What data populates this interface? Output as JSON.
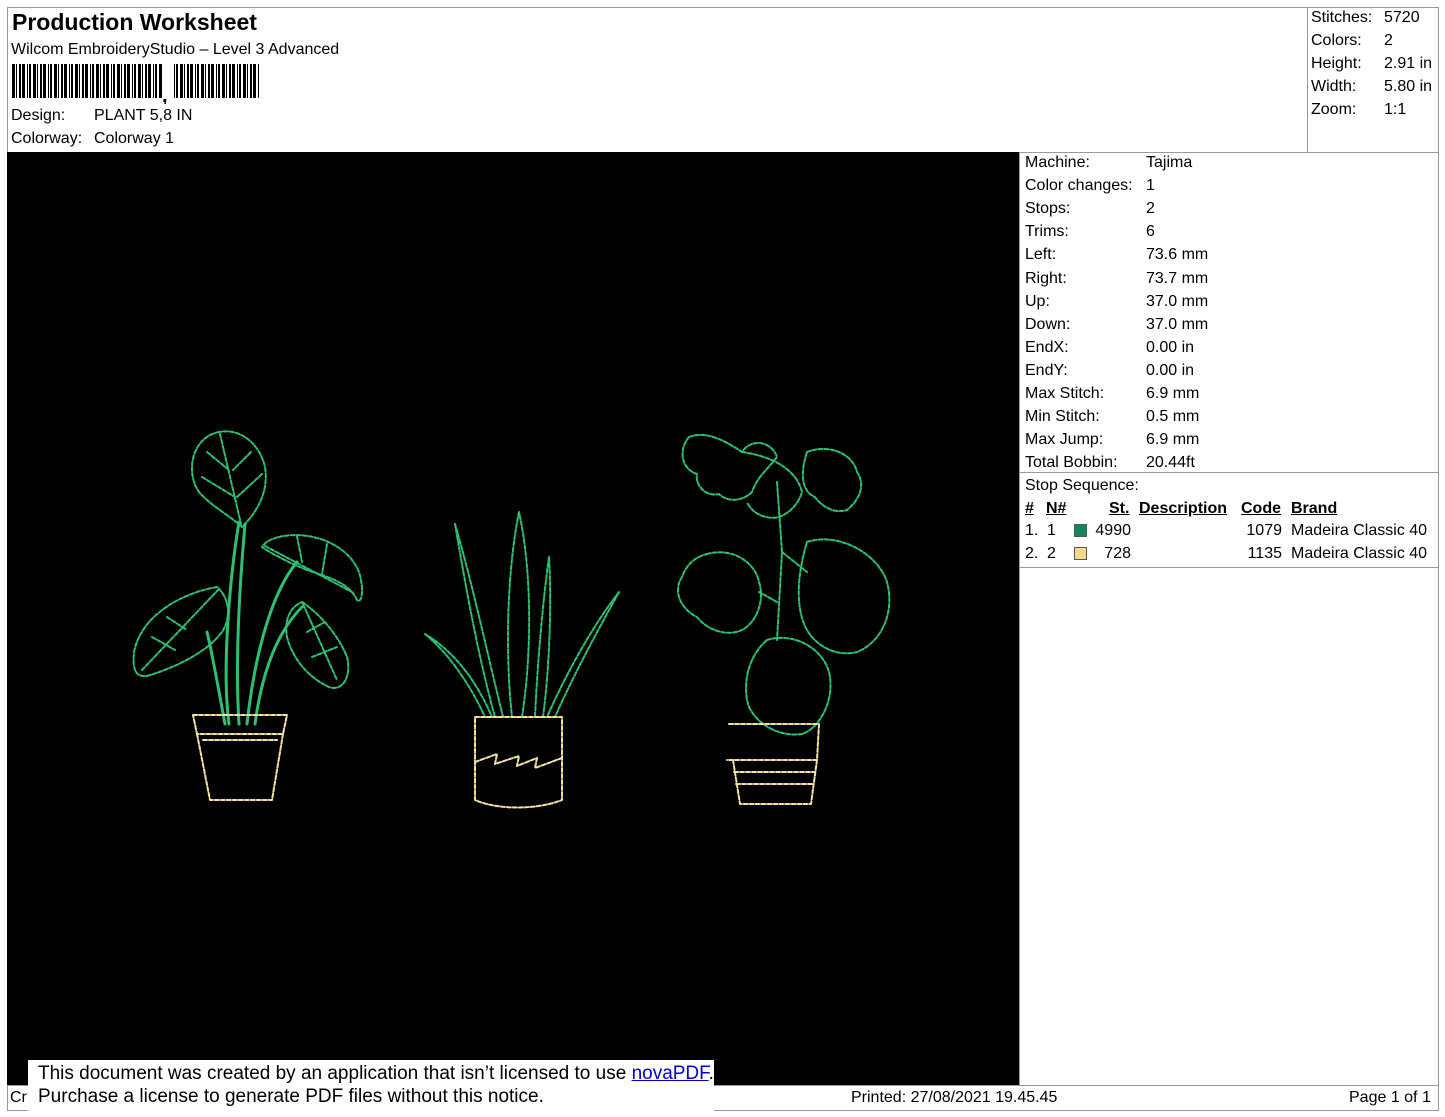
{
  "header": {
    "title": "Production Worksheet",
    "software": "Wilcom EmbroideryStudio – Level 3 Advanced",
    "design_label": "Design:",
    "design_value": "PLANT 5,8 IN",
    "colorway_label": "Colorway:",
    "colorway_value": "Colorway 1"
  },
  "summary": [
    {
      "label": "Stitches:",
      "value": "5720"
    },
    {
      "label": "Colors:",
      "value": "2"
    },
    {
      "label": "Height:",
      "value": "2.91 in"
    },
    {
      "label": "Width:",
      "value": "5.80 in"
    },
    {
      "label": "Zoom:",
      "value": "1:1"
    }
  ],
  "details": [
    {
      "label": "Machine:",
      "value": "Tajima"
    },
    {
      "label": "Color changes:",
      "value": "1"
    },
    {
      "label": "Stops:",
      "value": "2"
    },
    {
      "label": "Trims:",
      "value": "6"
    },
    {
      "label": "Left:",
      "value": "73.6 mm"
    },
    {
      "label": "Right:",
      "value": "73.7 mm"
    },
    {
      "label": "Up:",
      "value": "37.0 mm"
    },
    {
      "label": "Down:",
      "value": "37.0 mm"
    },
    {
      "label": "EndX:",
      "value": "0.00 in"
    },
    {
      "label": "EndY:",
      "value": "0.00 in"
    },
    {
      "label": "Max Stitch:",
      "value": "6.9 mm"
    },
    {
      "label": "Min Stitch:",
      "value": "0.5 mm"
    },
    {
      "label": "Max Jump:",
      "value": "6.9 mm"
    },
    {
      "label": "Total Bobbin:",
      "value": "20.44ft"
    }
  ],
  "stop_sequence": {
    "title": "Stop Sequence:",
    "columns": [
      "#",
      "N#",
      "St.",
      "Description",
      "Code",
      "Brand"
    ],
    "rows": [
      {
        "index": "1.",
        "n": "1",
        "color": "#12875a",
        "stitches": "4990",
        "description": "",
        "code": "1079",
        "brand": "Madeira Classic 40"
      },
      {
        "index": "2.",
        "n": "2",
        "color": "#f5d88a",
        "stitches": "728",
        "description": "",
        "code": "1135",
        "brand": "Madeira Classic 40"
      }
    ]
  },
  "footer": {
    "left_stub": "Cr",
    "printed": "Printed: 27/08/2021 19.45.45",
    "page": "Page 1 of 1"
  },
  "notice": {
    "line1": "This document was created by an application that isn’t licensed to use ",
    "link": "novaPDF",
    "line1_end": ".",
    "line2": "Purchase a license to generate PDF files without this notice."
  },
  "colors": {
    "thread_green": "#2fbf73",
    "thread_yellow": "#f3e2a0",
    "canvas": "#000000"
  }
}
